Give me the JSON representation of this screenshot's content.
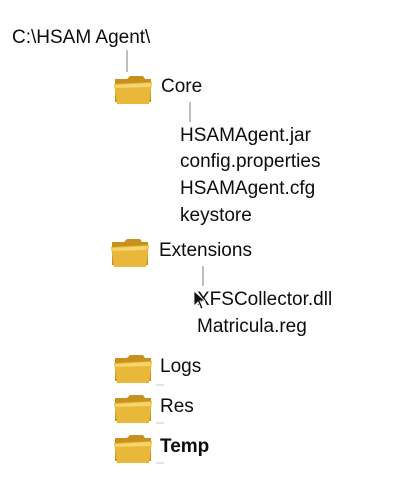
{
  "root": {
    "path": "C:\\HSAM Agent\\"
  },
  "folders": {
    "core": {
      "name": "Core",
      "files": [
        "HSAMAgent.jar",
        "config.properties",
        "HSAMAgent.cfg",
        "keystore"
      ]
    },
    "extensions": {
      "name": "Extensions",
      "files": [
        "XFSCollector.dll",
        "Matricula.reg"
      ]
    },
    "logs": {
      "name": "Logs"
    },
    "res": {
      "name": "Res"
    },
    "temp": {
      "name": "Temp"
    }
  },
  "colors": {
    "connector": "#7f7f7f",
    "folder_body": "#e9b73a",
    "folder_back": "#c8901c",
    "folder_highlight": "#f8dc7c"
  },
  "icons": {
    "folder": "folder-icon",
    "cursor": "mouse-cursor-icon"
  }
}
